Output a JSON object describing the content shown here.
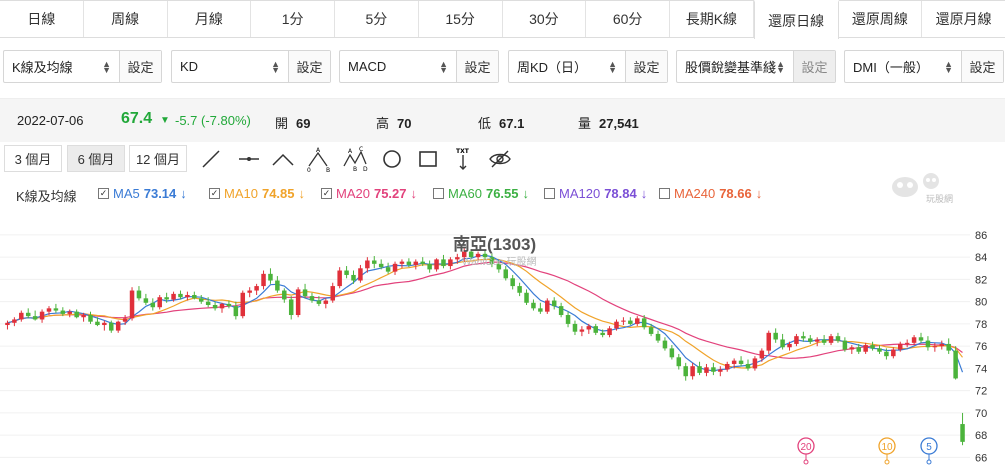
{
  "tabs": [
    {
      "label": "日線"
    },
    {
      "label": "周線"
    },
    {
      "label": "月線"
    },
    {
      "label": "1分"
    },
    {
      "label": "5分"
    },
    {
      "label": "15分"
    },
    {
      "label": "30分"
    },
    {
      "label": "60分"
    },
    {
      "label": "長期K線"
    },
    {
      "label": "還原日線"
    },
    {
      "label": "還原周線"
    },
    {
      "label": "還原月線"
    }
  ],
  "active_tab": "還原日線",
  "selectors": [
    {
      "value": "K線及均線",
      "button": "設定"
    },
    {
      "value": "KD",
      "button": "設定"
    },
    {
      "value": "MACD",
      "button": "設定"
    },
    {
      "value": "周KD（日）",
      "button": "設定"
    },
    {
      "value": "股價銳變基準綫",
      "button": "設定"
    },
    {
      "value": "DMI（一般）",
      "button": "設定"
    }
  ],
  "quote": {
    "date": "2022-07-06",
    "price": "67.4",
    "change_arrow": "▼",
    "change": "-5.7 (-7.80%)",
    "open_label": "開",
    "open": "69",
    "high_label": "高",
    "high": "70",
    "low_label": "低",
    "low": "67.1",
    "volume_label": "量",
    "volume": "27,541"
  },
  "ranges": [
    {
      "label": "3 個月"
    },
    {
      "label": "6 個月"
    },
    {
      "label": "12 個月"
    }
  ],
  "active_range": "6 個月",
  "tools": [
    "line-tool-icon",
    "horizontal-line-icon",
    "trend-angle-icon",
    "abc-pattern-icon",
    "abcd-pattern-icon",
    "circle-tool-icon",
    "rectangle-tool-icon",
    "text-tool-icon",
    "hide-drawings-icon"
  ],
  "ma_legend": {
    "title": "K線及均線",
    "items": [
      {
        "name": "MA5",
        "value": "73.14",
        "arrow": "↓",
        "checked": true,
        "color": "#3a7bd5"
      },
      {
        "name": "MA10",
        "value": "74.85",
        "arrow": "↓",
        "checked": true,
        "color": "#f0a32a"
      },
      {
        "name": "MA20",
        "value": "75.27",
        "arrow": "↓",
        "checked": true,
        "color": "#e2427c"
      },
      {
        "name": "MA60",
        "value": "76.55",
        "arrow": "↓",
        "checked": false,
        "color": "#3cb043"
      },
      {
        "name": "MA120",
        "value": "78.84",
        "arrow": "↓",
        "checked": false,
        "color": "#7b4fd6"
      },
      {
        "name": "MA240",
        "value": "78.66",
        "arrow": "↓",
        "checked": false,
        "color": "#e8643a"
      }
    ]
  },
  "chart": {
    "watermark_title": "南亞(1303)",
    "watermark_sub": "WantGoo 玩股網",
    "logo_text": "玩股網",
    "colors": {
      "up": "#e0303a",
      "down": "#4bb33b"
    }
  },
  "chart_data": {
    "type": "candlestick",
    "yticks": [
      66,
      68,
      70,
      72,
      74,
      76,
      78,
      80,
      82,
      84,
      86
    ],
    "ylim": [
      65.5,
      86.8
    ],
    "candles": [
      [
        77.9,
        78.3,
        77.5,
        78.1
      ],
      [
        78.1,
        78.6,
        77.8,
        78.4
      ],
      [
        78.4,
        79.2,
        78.2,
        79.0
      ],
      [
        79.0,
        79.4,
        78.5,
        78.7
      ],
      [
        78.7,
        79.2,
        78.3,
        78.4
      ],
      [
        78.4,
        79.3,
        78.1,
        79.1
      ],
      [
        79.1,
        79.6,
        78.8,
        79.4
      ],
      [
        79.4,
        79.8,
        79.0,
        79.2
      ],
      [
        79.2,
        79.5,
        78.7,
        78.9
      ],
      [
        78.9,
        79.3,
        78.6,
        79.1
      ],
      [
        79.1,
        79.3,
        78.5,
        78.6
      ],
      [
        78.6,
        79.0,
        78.2,
        78.8
      ],
      [
        78.8,
        79.1,
        78.0,
        78.2
      ],
      [
        78.2,
        78.6,
        77.8,
        77.9
      ],
      [
        77.9,
        78.3,
        77.4,
        78.1
      ],
      [
        78.1,
        78.3,
        77.2,
        77.4
      ],
      [
        77.4,
        78.3,
        77.2,
        78.2
      ],
      [
        78.2,
        78.8,
        77.9,
        78.5
      ],
      [
        78.5,
        81.3,
        78.3,
        81.0
      ],
      [
        81.0,
        81.4,
        80.1,
        80.3
      ],
      [
        80.3,
        80.7,
        79.7,
        79.9
      ],
      [
        79.9,
        80.3,
        79.2,
        79.5
      ],
      [
        79.5,
        80.6,
        79.3,
        80.4
      ],
      [
        80.4,
        80.8,
        79.9,
        80.2
      ],
      [
        80.2,
        80.9,
        80.0,
        80.7
      ],
      [
        80.7,
        81.0,
        80.2,
        80.4
      ],
      [
        80.4,
        80.9,
        80.1,
        80.6
      ],
      [
        80.6,
        80.9,
        80.2,
        80.3
      ],
      [
        80.3,
        80.6,
        79.8,
        80.0
      ],
      [
        80.0,
        80.4,
        79.5,
        79.7
      ],
      [
        79.7,
        80.0,
        79.2,
        79.4
      ],
      [
        79.4,
        79.9,
        79.0,
        79.8
      ],
      [
        79.8,
        80.1,
        79.4,
        79.6
      ],
      [
        79.6,
        80.0,
        78.4,
        78.7
      ],
      [
        78.7,
        81.0,
        78.5,
        80.8
      ],
      [
        80.8,
        81.3,
        80.4,
        81.0
      ],
      [
        81.0,
        81.6,
        80.6,
        81.4
      ],
      [
        81.4,
        82.8,
        81.1,
        82.5
      ],
      [
        82.5,
        83.0,
        81.6,
        81.9
      ],
      [
        81.9,
        82.3,
        80.8,
        81.0
      ],
      [
        81.0,
        81.2,
        79.9,
        80.2
      ],
      [
        80.2,
        80.5,
        78.4,
        78.8
      ],
      [
        78.8,
        81.3,
        78.6,
        81.1
      ],
      [
        81.1,
        81.6,
        80.3,
        80.5
      ],
      [
        80.5,
        80.8,
        79.9,
        80.1
      ],
      [
        80.1,
        80.5,
        79.6,
        79.8
      ],
      [
        79.8,
        80.3,
        79.4,
        80.1
      ],
      [
        80.1,
        81.7,
        79.9,
        81.4
      ],
      [
        81.4,
        83.1,
        81.2,
        82.8
      ],
      [
        82.8,
        83.2,
        82.1,
        82.4
      ],
      [
        82.4,
        82.8,
        81.6,
        81.9
      ],
      [
        81.9,
        83.3,
        81.7,
        83.0
      ],
      [
        83.0,
        84.0,
        82.6,
        83.7
      ],
      [
        83.7,
        84.1,
        83.0,
        83.4
      ],
      [
        83.4,
        83.8,
        82.9,
        83.1
      ],
      [
        83.1,
        83.5,
        82.5,
        82.7
      ],
      [
        82.7,
        83.6,
        82.4,
        83.4
      ],
      [
        83.4,
        83.8,
        83.0,
        83.6
      ],
      [
        83.6,
        83.9,
        83.1,
        83.3
      ],
      [
        83.3,
        83.8,
        82.9,
        83.6
      ],
      [
        83.6,
        84.0,
        83.2,
        83.4
      ],
      [
        83.4,
        83.7,
        82.6,
        82.9
      ],
      [
        82.9,
        83.9,
        82.7,
        83.8
      ],
      [
        83.8,
        84.2,
        83.0,
        83.2
      ],
      [
        83.2,
        84.0,
        82.9,
        83.8
      ],
      [
        83.8,
        84.3,
        83.4,
        84.0
      ],
      [
        84.0,
        84.8,
        83.6,
        84.5
      ],
      [
        84.5,
        84.7,
        83.8,
        84.0
      ],
      [
        84.0,
        84.5,
        83.6,
        84.3
      ],
      [
        84.3,
        84.6,
        83.8,
        84.0
      ],
      [
        84.0,
        84.3,
        83.1,
        83.4
      ],
      [
        83.4,
        83.7,
        82.6,
        82.9
      ],
      [
        82.9,
        83.2,
        81.9,
        82.1
      ],
      [
        82.1,
        82.4,
        81.1,
        81.4
      ],
      [
        81.4,
        81.7,
        80.5,
        80.8
      ],
      [
        80.8,
        81.1,
        79.7,
        79.9
      ],
      [
        79.9,
        80.2,
        79.2,
        79.4
      ],
      [
        79.4,
        79.9,
        78.9,
        79.1
      ],
      [
        79.1,
        80.3,
        78.9,
        80.1
      ],
      [
        80.1,
        80.4,
        79.3,
        79.6
      ],
      [
        79.6,
        79.9,
        78.6,
        78.8
      ],
      [
        78.8,
        79.1,
        77.7,
        78.0
      ],
      [
        78.0,
        78.3,
        77.0,
        77.3
      ],
      [
        77.3,
        77.8,
        76.9,
        77.5
      ],
      [
        77.5,
        78.0,
        77.1,
        77.8
      ],
      [
        77.8,
        78.0,
        77.0,
        77.2
      ],
      [
        77.2,
        77.5,
        76.8,
        77.0
      ],
      [
        77.0,
        77.8,
        76.8,
        77.6
      ],
      [
        77.6,
        78.4,
        77.4,
        78.2
      ],
      [
        78.2,
        78.6,
        77.9,
        78.3
      ],
      [
        78.3,
        78.6,
        77.9,
        78.0
      ],
      [
        78.0,
        78.7,
        77.8,
        78.5
      ],
      [
        78.5,
        78.8,
        77.5,
        77.7
      ],
      [
        77.7,
        78.0,
        76.9,
        77.1
      ],
      [
        77.1,
        77.4,
        76.3,
        76.5
      ],
      [
        76.5,
        76.8,
        75.6,
        75.8
      ],
      [
        75.8,
        76.1,
        74.8,
        75.0
      ],
      [
        75.0,
        75.3,
        73.9,
        74.2
      ],
      [
        74.2,
        74.5,
        72.9,
        73.3
      ],
      [
        73.3,
        74.5,
        73.0,
        74.2
      ],
      [
        74.2,
        74.6,
        73.4,
        73.6
      ],
      [
        73.6,
        74.4,
        73.3,
        74.1
      ],
      [
        74.1,
        74.5,
        73.4,
        73.7
      ],
      [
        73.7,
        74.2,
        73.3,
        73.9
      ],
      [
        73.9,
        74.6,
        73.7,
        74.4
      ],
      [
        74.4,
        74.9,
        74.0,
        74.7
      ],
      [
        74.7,
        75.1,
        74.2,
        74.4
      ],
      [
        74.4,
        74.8,
        73.8,
        74.0
      ],
      [
        74.0,
        75.1,
        73.8,
        74.9
      ],
      [
        74.9,
        75.8,
        74.6,
        75.6
      ],
      [
        75.6,
        77.4,
        75.3,
        77.2
      ],
      [
        77.2,
        77.6,
        76.3,
        76.6
      ],
      [
        76.6,
        77.1,
        75.7,
        75.9
      ],
      [
        75.9,
        76.4,
        75.6,
        76.2
      ],
      [
        76.2,
        77.1,
        76.0,
        76.9
      ],
      [
        76.9,
        77.3,
        76.4,
        76.7
      ],
      [
        76.7,
        77.0,
        76.2,
        76.4
      ],
      [
        76.4,
        76.8,
        76.0,
        76.6
      ],
      [
        76.6,
        77.0,
        76.1,
        76.3
      ],
      [
        76.3,
        77.1,
        76.1,
        76.9
      ],
      [
        76.9,
        77.2,
        76.3,
        76.5
      ],
      [
        76.5,
        76.8,
        75.5,
        75.7
      ],
      [
        75.7,
        76.1,
        75.3,
        75.9
      ],
      [
        75.9,
        76.2,
        75.3,
        75.5
      ],
      [
        75.5,
        76.3,
        75.3,
        76.1
      ],
      [
        76.1,
        76.4,
        75.6,
        75.8
      ],
      [
        75.8,
        76.1,
        75.3,
        75.5
      ],
      [
        75.5,
        75.8,
        74.8,
        75.1
      ],
      [
        75.1,
        75.9,
        74.9,
        75.7
      ],
      [
        75.7,
        76.4,
        75.5,
        76.2
      ],
      [
        76.2,
        76.6,
        75.9,
        76.3
      ],
      [
        76.3,
        77.0,
        76.1,
        76.8
      ],
      [
        76.8,
        77.2,
        76.3,
        76.5
      ],
      [
        76.5,
        76.9,
        75.6,
        75.9
      ],
      [
        75.9,
        76.3,
        75.5,
        76.0
      ],
      [
        76.0,
        76.5,
        75.7,
        76.2
      ],
      [
        76.2,
        76.7,
        75.3,
        75.6
      ],
      [
        75.6,
        76.0,
        73.0,
        73.1
      ],
      [
        69.0,
        70.0,
        67.1,
        67.4
      ]
    ]
  },
  "markers": [
    {
      "label": "20",
      "color": "#e2427c"
    },
    {
      "label": "10",
      "color": "#f0a32a"
    },
    {
      "label": "5",
      "color": "#3a7bd5"
    }
  ]
}
